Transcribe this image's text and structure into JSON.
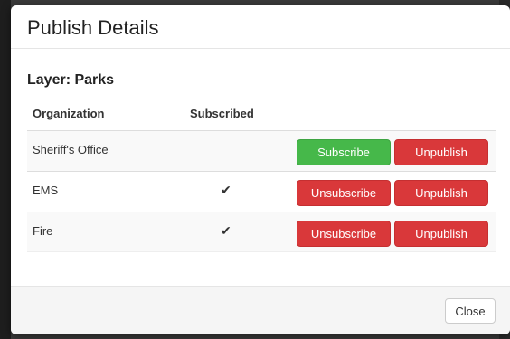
{
  "modal": {
    "title": "Publish Details",
    "layer_prefix": "Layer: ",
    "layer_name": "Parks"
  },
  "table": {
    "headers": [
      "Organization",
      "Subscribed"
    ],
    "rows": [
      {
        "organization": "Sheriff's Office",
        "subscribed": "",
        "action_label": "Subscribe",
        "unpublish_label": "Unpublish"
      },
      {
        "organization": "EMS",
        "subscribed": "✔",
        "action_label": "Unsubscribe",
        "unpublish_label": "Unpublish"
      },
      {
        "organization": "Fire",
        "subscribed": "✔",
        "action_label": "Unsubscribe",
        "unpublish_label": "Unpublish"
      }
    ]
  },
  "footer": {
    "close_label": "Close"
  },
  "colors": {
    "success": "#46b84a",
    "danger": "#d9383a"
  }
}
